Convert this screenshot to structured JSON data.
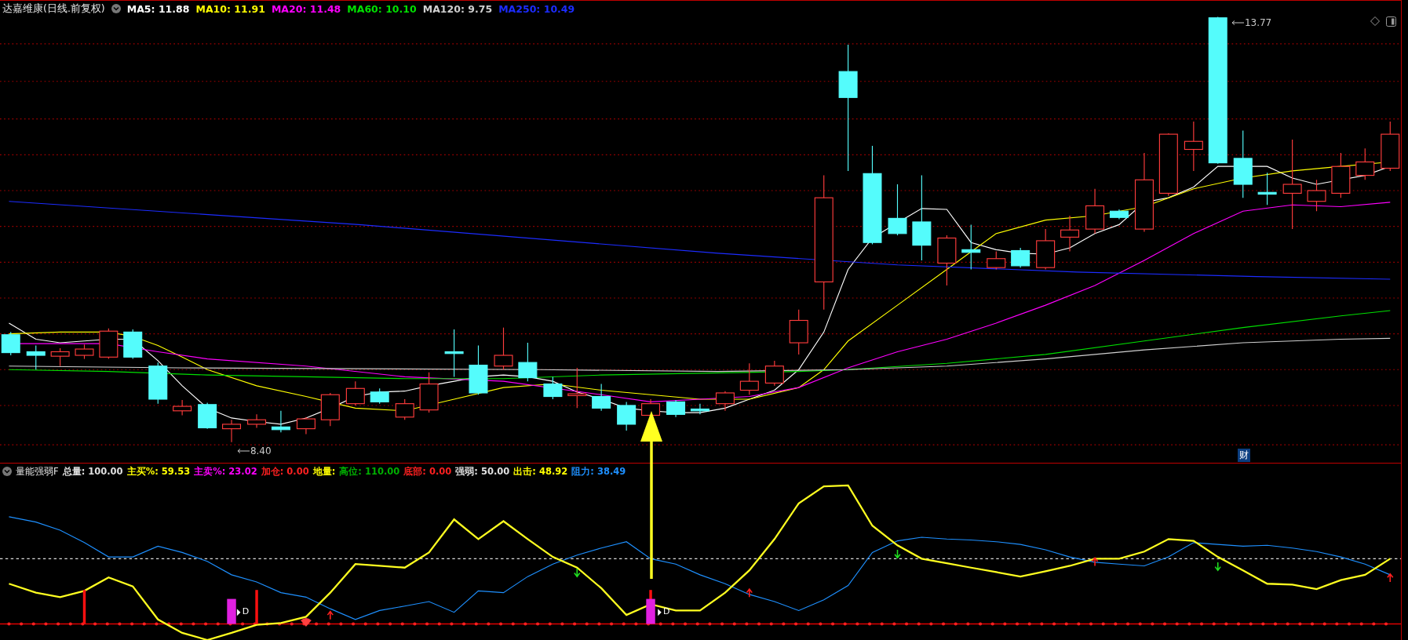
{
  "main_panel": {
    "title": "达嘉维康(日线.前复权)",
    "moving_averages": [
      {
        "label": "MA5:",
        "value": "11.88",
        "color": "#ffffff"
      },
      {
        "label": "MA10:",
        "value": "11.91",
        "color": "#ffff00"
      },
      {
        "label": "MA20:",
        "value": "11.48",
        "color": "#ff00ff"
      },
      {
        "label": "MA60:",
        "value": "10.10",
        "color": "#00e000"
      },
      {
        "label": "MA120:",
        "value": "9.75",
        "color": "#d0d0d0"
      },
      {
        "label": "MA250:",
        "value": "10.49",
        "color": "#1c2cff"
      }
    ],
    "price_labels": [
      {
        "kind": "high",
        "text": "13.77"
      },
      {
        "kind": "low",
        "text": "8.40"
      }
    ],
    "badge": "财"
  },
  "indicator_panel": {
    "title": "量能强弱F",
    "readings": [
      {
        "label": "总量:",
        "value": "100.00",
        "color": "#e0e0e0"
      },
      {
        "label": "主买%:",
        "value": "59.53",
        "color": "#ffff00"
      },
      {
        "label": "主卖%:",
        "value": "23.02",
        "color": "#ff00ff"
      },
      {
        "label": "加仓:",
        "value": "0.00",
        "color": "#ff2020"
      },
      {
        "label": "地量:",
        "color": "#ffff00"
      },
      {
        "label": "高位:",
        "value": "110.00",
        "color": "#00b000"
      },
      {
        "label": "底部:",
        "value": "0.00",
        "color": "#ff2020"
      },
      {
        "label": "强弱:",
        "value": "50.00",
        "color": "#e0e0e0"
      },
      {
        "label": "出击:",
        "value": "48.92",
        "color": "#ffff00"
      },
      {
        "label": "阻力:",
        "value": "38.49",
        "color": "#1e90ff"
      }
    ],
    "signals": [
      {
        "text": "D"
      },
      {
        "text": "D"
      }
    ]
  }
}
